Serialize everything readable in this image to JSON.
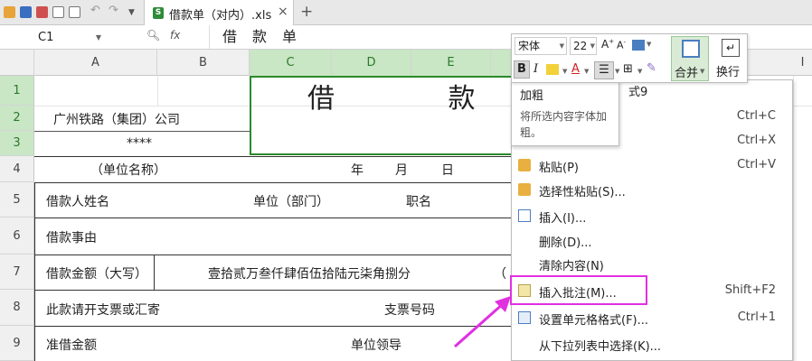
{
  "tab": {
    "title": "借款单（对内）.xls",
    "close": "×",
    "new": "+"
  },
  "formula": {
    "cell_ref": "C1",
    "fx": "fx",
    "value": "借款单"
  },
  "columns": [
    "A",
    "B",
    "C",
    "D",
    "E",
    "I"
  ],
  "rows": [
    "1",
    "2",
    "3",
    "4",
    "5",
    "6",
    "7",
    "8",
    "9"
  ],
  "sheet": {
    "title": "借 款 单",
    "company": "广州铁路（集团）公司",
    "stars": "****",
    "unit_name": "（单位名称）",
    "year": "年",
    "month": "月",
    "day": "日",
    "borrower": "借款人姓名",
    "dept": "单位（部门）",
    "position": "职名",
    "matter": "借款事由",
    "amount_label": "借款金额（大写）",
    "amount_words": "壹拾贰万叁仟肆佰伍拾陆元柒角捌分",
    "paren": "（",
    "cheque": "此款请开支票或汇寄",
    "cheque_no": "支票号码",
    "approved": "准借金额",
    "leader": "单位领导",
    "partial": "式9"
  },
  "mini_toolbar": {
    "font": "宋体",
    "size": "22",
    "bold": "B",
    "italic": "I",
    "font_color": "A",
    "merge": "合并",
    "wrap": "换行"
  },
  "tooltip": {
    "title": "加粗",
    "desc": "将所选内容字体加粗。"
  },
  "menu": [
    {
      "label": "",
      "shortcut": "Ctrl+C"
    },
    {
      "label": "",
      "shortcut": "Ctrl+X"
    },
    {
      "label": "粘贴(P)",
      "shortcut": "Ctrl+V"
    },
    {
      "label": "选择性粘贴(S)...",
      "shortcut": ""
    },
    {
      "label": "插入(I)...",
      "shortcut": ""
    },
    {
      "label": "删除(D)...",
      "shortcut": ""
    },
    {
      "label": "清除内容(N)",
      "shortcut": ""
    },
    {
      "label": "插入批注(M)...",
      "shortcut": "Shift+F2"
    },
    {
      "label": "设置单元格格式(F)...",
      "shortcut": "Ctrl+1"
    },
    {
      "label": "从下拉列表中选择(K)...",
      "shortcut": ""
    }
  ],
  "colors": {
    "selection": "#2a8a2a",
    "highlight": "#e030e0",
    "header_sel": "#c9e6c5"
  }
}
